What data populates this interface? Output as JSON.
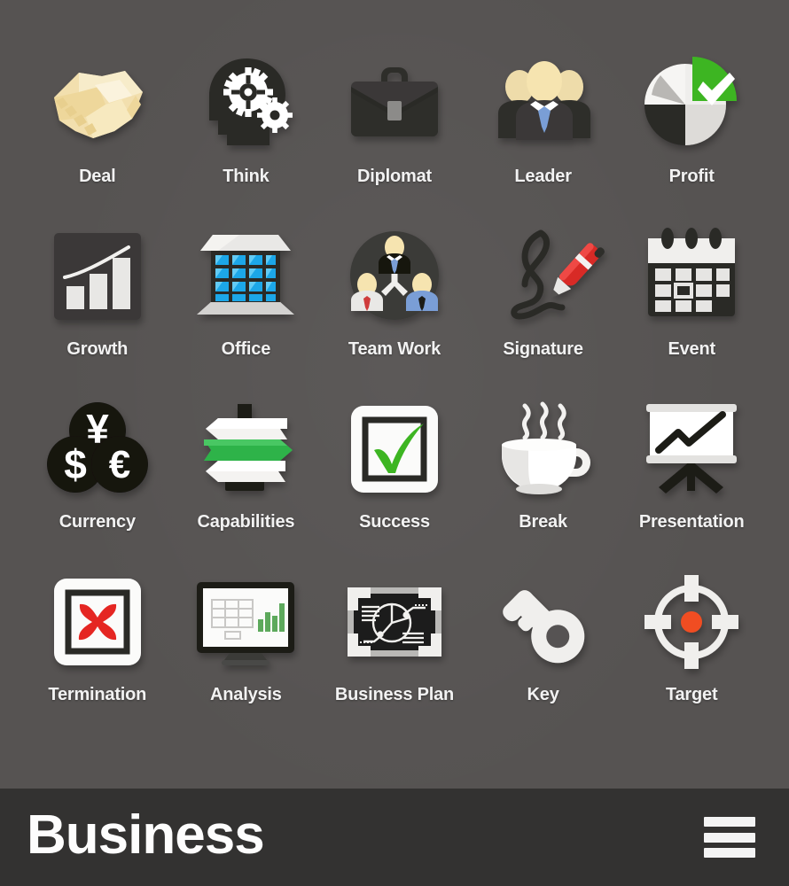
{
  "page": {
    "background_color": "#565352",
    "accent_green": "#3cb521",
    "accent_red": "#e52521",
    "accent_blue": "#1ba7e8",
    "accent_orange": "#f04e23",
    "label_color": "#f2f2f2"
  },
  "grid": {
    "columns": 5,
    "rows": 4,
    "items": [
      {
        "id": "deal",
        "label": "Deal",
        "icon": "handshake-icon"
      },
      {
        "id": "think",
        "label": "Think",
        "icon": "head-gears-icon"
      },
      {
        "id": "diplomat",
        "label": "Diplomat",
        "icon": "briefcase-icon"
      },
      {
        "id": "leader",
        "label": "Leader",
        "icon": "business-people-icon"
      },
      {
        "id": "profit",
        "label": "Profit",
        "icon": "pie-chart-check-icon"
      },
      {
        "id": "growth",
        "label": "Growth",
        "icon": "bar-chart-trend-icon"
      },
      {
        "id": "office",
        "label": "Office",
        "icon": "office-building-icon"
      },
      {
        "id": "team-work",
        "label": "Team Work",
        "icon": "team-hierarchy-icon"
      },
      {
        "id": "signature",
        "label": "Signature",
        "icon": "pen-signature-icon"
      },
      {
        "id": "event",
        "label": "Event",
        "icon": "calendar-icon"
      },
      {
        "id": "currency",
        "label": "Currency",
        "icon": "currency-coins-icon"
      },
      {
        "id": "capabilities",
        "label": "Capabilities",
        "icon": "signpost-icon"
      },
      {
        "id": "success",
        "label": "Success",
        "icon": "checkbox-tick-icon"
      },
      {
        "id": "break",
        "label": "Break",
        "icon": "coffee-cup-icon"
      },
      {
        "id": "presentation",
        "label": "Presentation",
        "icon": "presentation-screen-icon"
      },
      {
        "id": "termination",
        "label": "Termination",
        "icon": "checkbox-cross-icon"
      },
      {
        "id": "analysis",
        "label": "Analysis",
        "icon": "monitor-chart-icon"
      },
      {
        "id": "business-plan",
        "label": "Business Plan",
        "icon": "blackboard-pie-icon"
      },
      {
        "id": "key",
        "label": "Key",
        "icon": "key-icon"
      },
      {
        "id": "target",
        "label": "Target",
        "icon": "crosshair-target-icon"
      }
    ]
  },
  "footer": {
    "title": "Business",
    "menu_icon": "hamburger-menu-icon",
    "background_color": "#333231"
  }
}
